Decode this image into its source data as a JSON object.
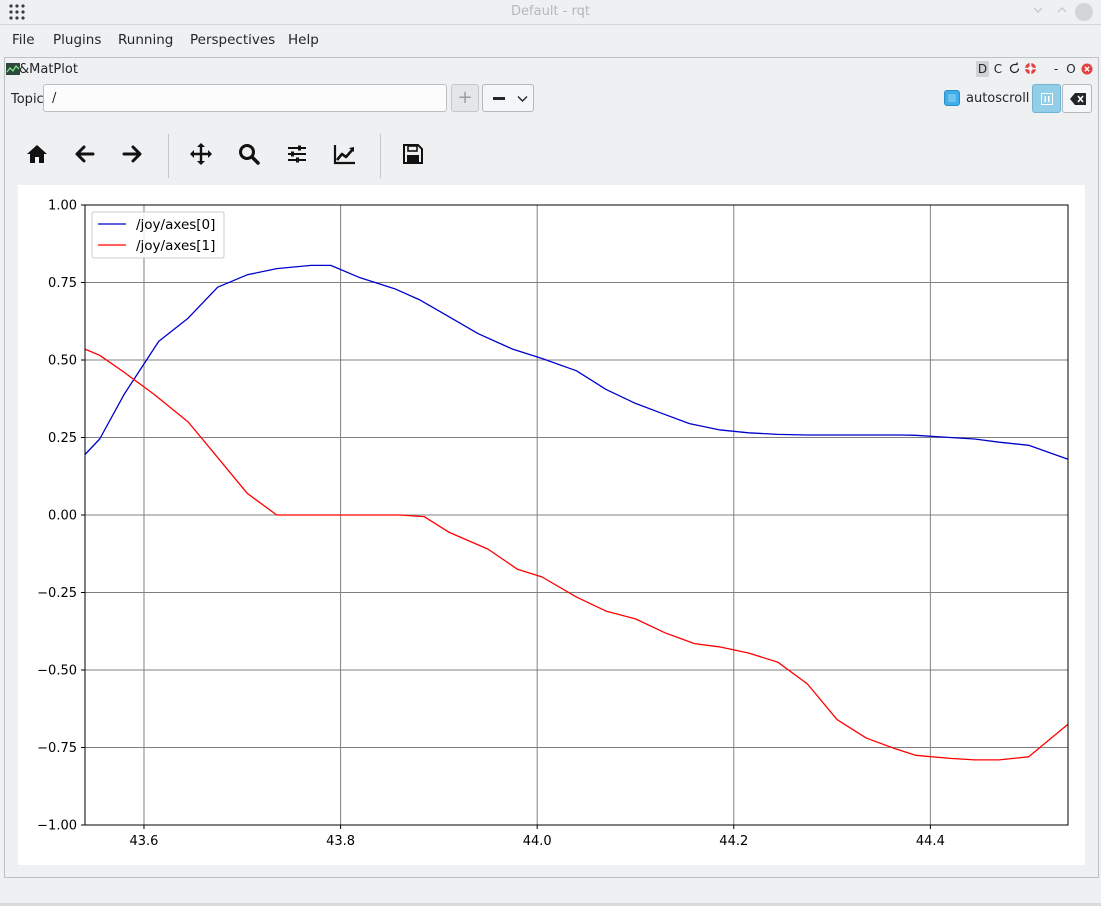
{
  "window": {
    "title": "Default - rqt"
  },
  "menubar": {
    "items": [
      "File",
      "Plugins",
      "Running",
      "Perspectives",
      "Help"
    ]
  },
  "dock": {
    "title": "&MatPlot",
    "controls": {
      "d_label": "D",
      "c_label": "C",
      "minimize_label": "-",
      "float_label": "O"
    }
  },
  "topic": {
    "label": "Topic",
    "value": "/",
    "add_label": "+"
  },
  "autoscroll": {
    "label": "autoscroll",
    "checked": true
  },
  "toolbar": {
    "icons": [
      "home-icon",
      "back-icon",
      "forward-icon",
      "pan-icon",
      "zoom-icon",
      "configure-icon",
      "edit-axes-icon",
      "save-icon"
    ]
  },
  "chart_data": {
    "type": "line",
    "xlim": [
      43.54,
      44.54
    ],
    "ylim": [
      -1.0,
      1.0
    ],
    "xticks": [
      43.6,
      43.8,
      44.0,
      44.2,
      44.4
    ],
    "xtick_labels": [
      "43.6",
      "43.8",
      "44.0",
      "44.2",
      "44.4"
    ],
    "yticks": [
      1.0,
      0.75,
      0.5,
      0.25,
      0.0,
      -0.25,
      -0.5,
      -0.75,
      -1.0
    ],
    "ytick_labels": [
      "1.00",
      "0.75",
      "0.50",
      "0.25",
      "0.00",
      "−0.25",
      "−0.50",
      "−0.75",
      "−1.00"
    ],
    "grid": true,
    "legend_placement": "top-left",
    "series": [
      {
        "name": "/joy/axes[0]",
        "color": "#0000cc",
        "x": [
          43.54,
          43.555,
          43.58,
          43.615,
          43.645,
          43.675,
          43.705,
          43.735,
          43.77,
          43.79,
          43.82,
          43.855,
          43.88,
          43.91,
          43.94,
          43.975,
          44.005,
          44.04,
          44.07,
          44.1,
          44.125,
          44.155,
          44.185,
          44.215,
          44.245,
          44.275,
          44.31,
          44.34,
          44.37,
          44.385,
          44.42,
          44.445,
          44.47,
          44.5,
          44.54
        ],
        "y": [
          0.195,
          0.245,
          0.39,
          0.56,
          0.635,
          0.735,
          0.775,
          0.795,
          0.805,
          0.805,
          0.765,
          0.73,
          0.695,
          0.64,
          0.585,
          0.535,
          0.505,
          0.465,
          0.405,
          0.36,
          0.33,
          0.295,
          0.275,
          0.265,
          0.26,
          0.258,
          0.258,
          0.258,
          0.258,
          0.257,
          0.25,
          0.245,
          0.235,
          0.225,
          0.18
        ]
      },
      {
        "name": "/joy/axes[1]",
        "color": "#ff0000",
        "x": [
          43.54,
          43.555,
          43.58,
          43.61,
          43.645,
          43.675,
          43.705,
          43.735,
          43.77,
          43.8,
          43.83,
          43.86,
          43.885,
          43.91,
          43.95,
          43.98,
          44.005,
          44.04,
          44.07,
          44.1,
          44.13,
          44.16,
          44.185,
          44.215,
          44.245,
          44.275,
          44.305,
          44.335,
          44.365,
          44.385,
          44.42,
          44.445,
          44.47,
          44.5,
          44.54
        ],
        "y": [
          0.535,
          0.515,
          0.46,
          0.39,
          0.3,
          0.185,
          0.07,
          0.0,
          0.0,
          0.0,
          0.0,
          0.0,
          -0.005,
          -0.055,
          -0.11,
          -0.175,
          -0.2,
          -0.265,
          -0.31,
          -0.335,
          -0.38,
          -0.415,
          -0.425,
          -0.445,
          -0.475,
          -0.545,
          -0.66,
          -0.72,
          -0.755,
          -0.775,
          -0.785,
          -0.79,
          -0.79,
          -0.78,
          -0.675
        ]
      }
    ]
  }
}
